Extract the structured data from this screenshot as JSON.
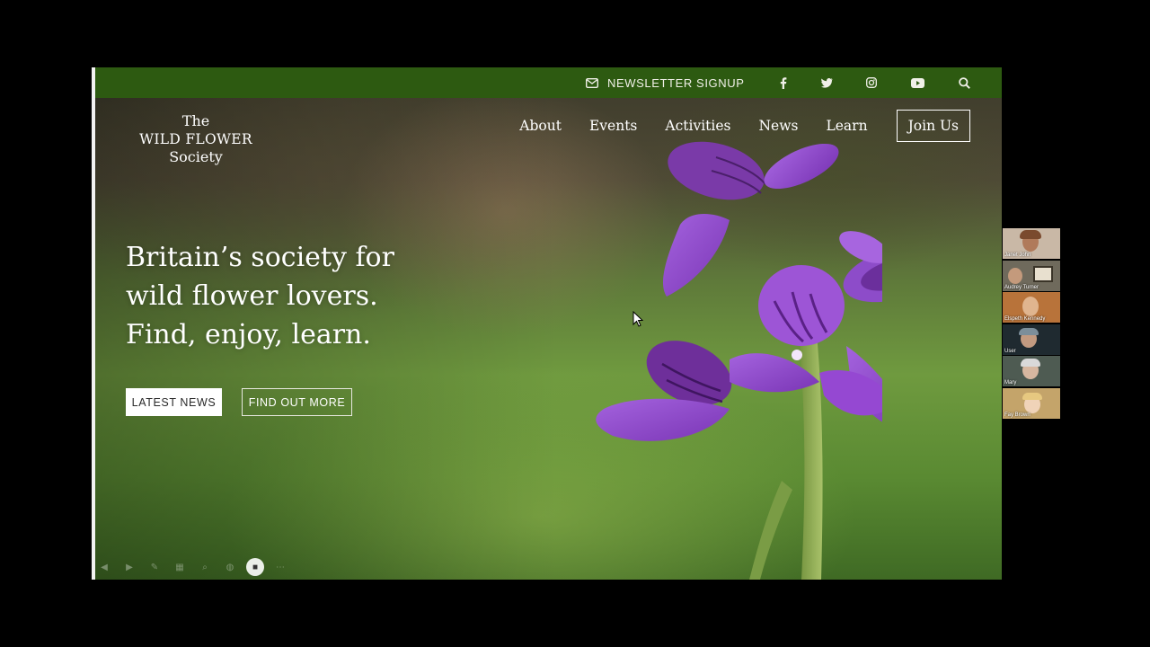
{
  "topbar": {
    "newsletter_label": "NEWSLETTER SIGNUP",
    "social_icons": [
      "facebook-icon",
      "twitter-icon",
      "instagram-icon",
      "youtube-icon"
    ],
    "search_icon": "search-icon"
  },
  "logo": {
    "line1": "The",
    "line2": "WILD FLOWER",
    "line3": "Society"
  },
  "nav": {
    "items": [
      "About",
      "Events",
      "Activities",
      "News",
      "Learn"
    ],
    "join_label": "Join Us"
  },
  "hero": {
    "headline_lines": [
      "Britain’s society for",
      "wild flower lovers.",
      "Find, enjoy, learn."
    ],
    "buttons": {
      "latest_news": "LATEST NEWS",
      "find_out_more": "FIND OUT MORE"
    }
  },
  "participants": [
    {
      "name": "Janet John",
      "bg": "#c9b8a6"
    },
    {
      "name": "Audrey Turner",
      "bg": "#6f6a5c"
    },
    {
      "name": "Elspeth Kennedy",
      "bg": "#b8733a"
    },
    {
      "name": "User",
      "bg": "#1f2a30"
    },
    {
      "name": "Mary",
      "bg": "#4e5b52"
    },
    {
      "name": "Fay Brown",
      "bg": "#c4a46a"
    }
  ],
  "colors": {
    "topbar": "#2d5a11",
    "orchid_purple": "#8a3fc4",
    "background": "#000000"
  }
}
